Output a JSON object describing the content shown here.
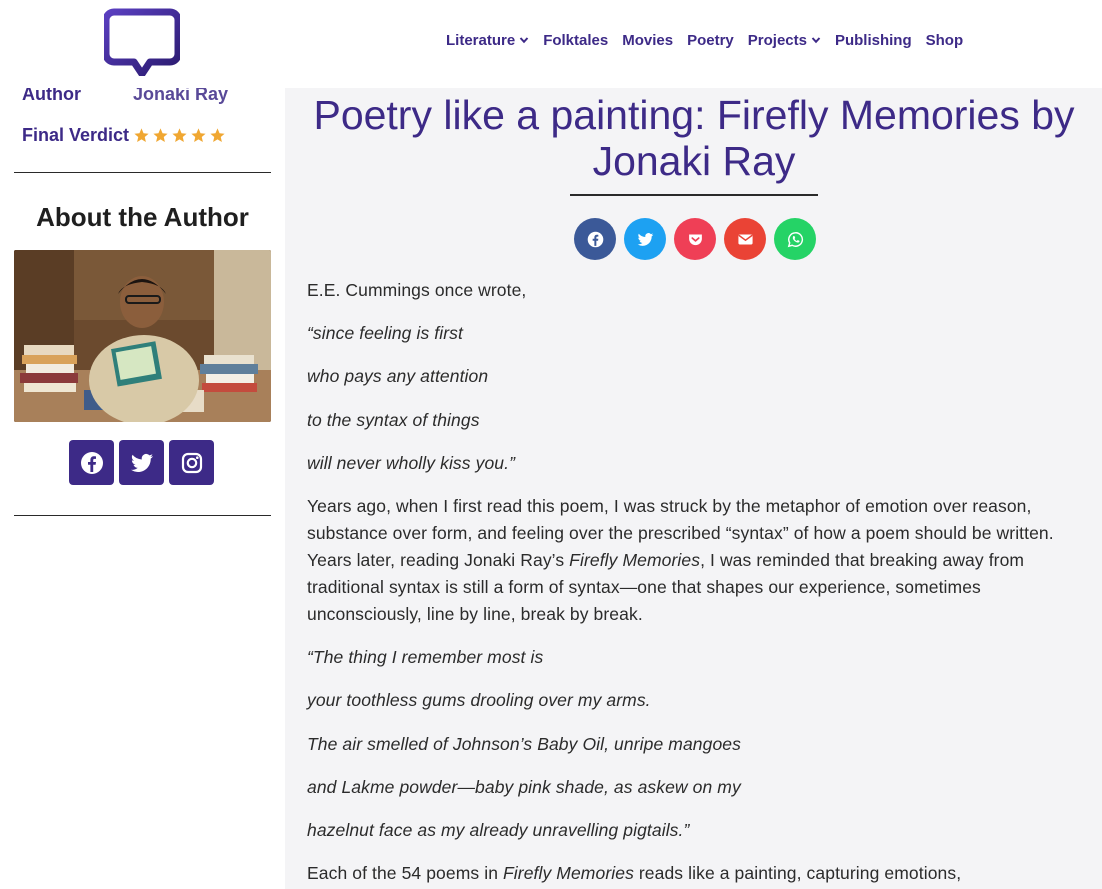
{
  "nav": {
    "items": [
      {
        "label": "Literature",
        "dropdown": true
      },
      {
        "label": "Folktales",
        "dropdown": false
      },
      {
        "label": "Movies",
        "dropdown": false
      },
      {
        "label": "Poetry",
        "dropdown": false
      },
      {
        "label": "Projects",
        "dropdown": true
      },
      {
        "label": "Publishing",
        "dropdown": false
      },
      {
        "label": "Shop",
        "dropdown": false
      }
    ]
  },
  "sidebar": {
    "author_label": "Author",
    "author_value": "Jonaki Ray",
    "verdict_label": "Final Verdict",
    "verdict_stars": 5,
    "about_title": "About the Author",
    "socials": [
      "facebook-icon",
      "twitter-icon",
      "instagram-icon"
    ]
  },
  "article": {
    "title": "Poetry like a painting: Firefly Memories by Jonaki Ray",
    "share": [
      "facebook-icon",
      "twitter-icon",
      "pocket-icon",
      "email-icon",
      "whatsapp-icon"
    ],
    "p1": "E.E. Cummings once wrote,",
    "quote1": [
      "“since feeling is first",
      "who pays any attention",
      "to the syntax of things",
      "will never wholly kiss you.”"
    ],
    "p2_part1": "Years ago, when I first read this poem, I was struck by the metaphor of emotion over reason, substance over form, and feeling over the prescribed “syntax” of how a poem should be written. Years later, reading Jonaki Ray’s ",
    "p2_italic": "Firefly Memories",
    "p2_part2": ", I was reminded that breaking away from traditional syntax is still a form of syntax—one that shapes our experience, sometimes unconsciously, line by line, break by break.",
    "quote2": [
      "“The thing I remember most is",
      "your toothless gums drooling over my arms.",
      "The air smelled of Johnson’s Baby Oil, unripe mangoes",
      "and Lakme powder—baby pink shade, as askew on my",
      "hazelnut face as my already unravelling pigtails.”"
    ],
    "p3_part1": "Each of the 54 poems in ",
    "p3_italic": "Firefly Memories",
    "p3_part2": " reads like a painting, capturing emotions,"
  },
  "colors": {
    "brand": "#3d2a87",
    "star": "#f0a732",
    "facebook": "#3b5998",
    "twitter": "#1da1f2",
    "pocket": "#ef3f56",
    "email": "#ea4335",
    "whatsapp": "#25d366"
  }
}
